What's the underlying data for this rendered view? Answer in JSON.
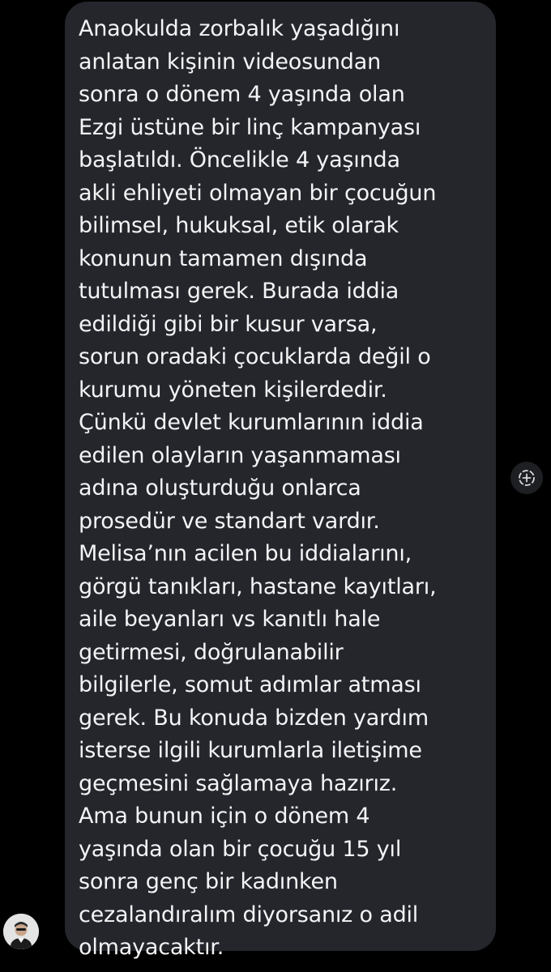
{
  "message": {
    "text": "Anaokulda zorbalık yaşadığını\nanlatan kişinin videosundan\nsonra o dönem 4 yaşında olan\nEzgi üstüne bir linç kampanyası\nbaşlatıldı. Öncelikle 4 yaşında\nakli ehliyeti olmayan bir çocuğun\nbilimsel, hukuksal, etik olarak\nkonunun tamamen dışında\ntutulması gerek. Burada iddia\nedildiği gibi bir kusur varsa,\nsorun oradaki çocuklarda değil o\nkurumu yöneten kişilerdedir.\nÇünkü devlet kurumlarının iddia\nedilen olayların yaşanmaması\nadına oluşturduğu onlarca\nprosedür ve standart vardır.\nMelisa’nın acilen bu iddialarını,\ngörgü tanıkları, hastane kayıtları,\naile beyanları vs kanıtlı hale\ngetirmesi, doğrulanabilir\nbilgilerle, somut adımlar atması\ngerek. Bu konuda bizden yardım\nisterse ilgili kurumlarla iletişime\ngeçmesini sağlamaya hazırız.\nAma bunun için o dönem 4\nyaşında olan bir çocuğu 15 yıl\nsonra genç bir kadınken\ncezalandıralım diyorsanız o adil\nolmayacaktır."
  },
  "reaction_button": {
    "icon": "add-reaction-icon"
  },
  "avatar": {
    "icon": "user-avatar"
  },
  "colors": {
    "background": "#000000",
    "bubble": "#24262c",
    "text": "#f4f4f6"
  }
}
